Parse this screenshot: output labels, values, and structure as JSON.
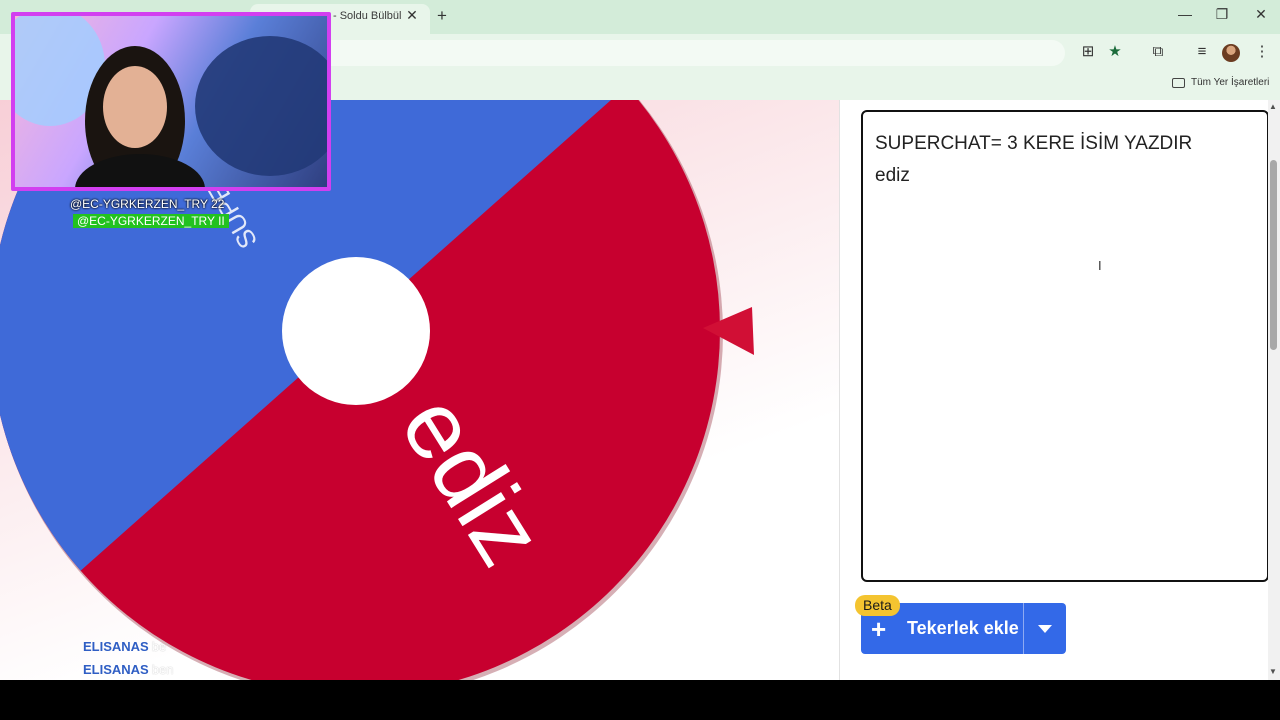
{
  "browser": {
    "tab_title": "- Soldu Bülbül",
    "tab_close": "✕",
    "new_tab": "+",
    "minimize": "—",
    "restore": "❐",
    "close": "✕",
    "bookmarks_label": "Tüm Yer İşaretleri"
  },
  "wheel": {
    "colors": {
      "blue": "#3f6ad8",
      "red": "#c7002f",
      "hub": "#ffffff",
      "pointer": "#d10f35"
    },
    "segments": [
      {
        "label": "SUPERCHAT= 3 KERE İSİM YAZDIR",
        "color": "#3f6ad8"
      },
      {
        "label": "ediz",
        "color": "#c7002f"
      }
    ],
    "visible_fragment": "SUPE",
    "winner_label": "ediz"
  },
  "entries": {
    "lines": [
      "SUPERCHAT= 3 KERE İSİM YAZDIR",
      "ediz"
    ],
    "caret": "I"
  },
  "add_wheel": {
    "beta_badge": "Beta",
    "label": "Tekerlek ekle",
    "button_color": "#3369e8"
  },
  "overlay": {
    "handles": [
      "@EC-YGRKERZEN_TRY 22",
      "@EC-YGRKERZEN_TRY II"
    ],
    "chat": [
      {
        "name": "ELISANAS",
        "message": "be"
      },
      {
        "name": "ELISANAS",
        "message": "ben"
      }
    ],
    "frame_color": "#d23ff0"
  }
}
